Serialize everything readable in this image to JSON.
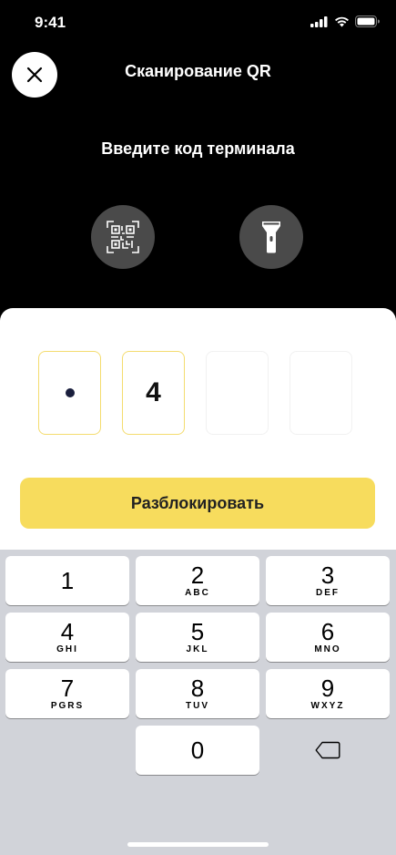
{
  "status": {
    "time": "9:41",
    "icons": [
      "signal-icon",
      "wifi-icon",
      "battery-icon"
    ]
  },
  "header": {
    "title": "Сканирование QR",
    "close_icon": "close-icon"
  },
  "prompt": "Введите код терминала",
  "actions": {
    "qr_icon": "qr-code-icon",
    "torch_icon": "flashlight-icon"
  },
  "code": {
    "cells": [
      {
        "state": "filled",
        "display": "dot",
        "value": "•"
      },
      {
        "state": "filled",
        "display": "digit",
        "value": "4"
      },
      {
        "state": "empty",
        "value": ""
      },
      {
        "state": "empty",
        "value": ""
      }
    ]
  },
  "unlock_button": "Разблокировать",
  "keypad": {
    "keys": [
      {
        "digit": "1",
        "letters": ""
      },
      {
        "digit": "2",
        "letters": "ABC"
      },
      {
        "digit": "3",
        "letters": "DEF"
      },
      {
        "digit": "4",
        "letters": "GHI"
      },
      {
        "digit": "5",
        "letters": "JKL"
      },
      {
        "digit": "6",
        "letters": "MNO"
      },
      {
        "digit": "7",
        "letters": "PGRS"
      },
      {
        "digit": "8",
        "letters": "TUV"
      },
      {
        "digit": "9",
        "letters": "WXYZ"
      },
      {
        "digit": "0",
        "letters": ""
      }
    ],
    "backspace_icon": "backspace-icon"
  },
  "colors": {
    "accent": "#f7dc5d",
    "cell_border_filled": "#f4dc6e",
    "keyboard_bg": "#d1d3d9",
    "header_bg": "#000000"
  }
}
